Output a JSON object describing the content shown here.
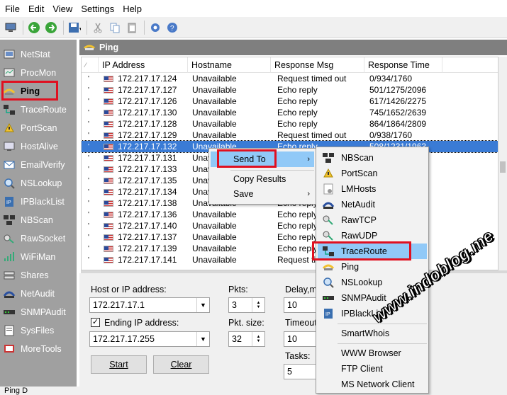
{
  "menu": [
    "File",
    "Edit",
    "View",
    "Settings",
    "Help"
  ],
  "toolbar_icons": [
    "monitor-icon",
    "back-icon",
    "forward-icon",
    "save-icon",
    "cut-icon",
    "copy-icon",
    "paste-icon",
    "settings-icon",
    "help-icon"
  ],
  "sidebar": {
    "items": [
      {
        "label": "NetStat",
        "icon": "netstat-icon"
      },
      {
        "label": "ProcMon",
        "icon": "procmon-icon"
      },
      {
        "label": "Ping",
        "icon": "ping-icon",
        "active": true
      },
      {
        "label": "TraceRoute",
        "icon": "traceroute-icon"
      },
      {
        "label": "PortScan",
        "icon": "portscan-icon"
      },
      {
        "label": "HostAlive",
        "icon": "hostalive-icon"
      },
      {
        "label": "EmailVerify",
        "icon": "email-icon"
      },
      {
        "label": "NSLookup",
        "icon": "nslookup-icon"
      },
      {
        "label": "IPBlackList",
        "icon": "ipblacklist-icon"
      },
      {
        "label": "NBScan",
        "icon": "nbscan-icon"
      },
      {
        "label": "RawSocket",
        "icon": "rawsocket-icon"
      },
      {
        "label": "WiFiMan",
        "icon": "wifi-icon"
      },
      {
        "label": "Shares",
        "icon": "shares-icon"
      },
      {
        "label": "NetAudit",
        "icon": "netaudit-icon"
      },
      {
        "label": "SNMPAudit",
        "icon": "snmpaudit-icon"
      },
      {
        "label": "SysFiles",
        "icon": "sysfiles-icon"
      },
      {
        "label": "MoreTools",
        "icon": "moretools-icon"
      }
    ]
  },
  "panel_title": "Ping",
  "table": {
    "columns": [
      "IP Address",
      "Hostname",
      "Response Msg",
      "Response Time"
    ],
    "rows": [
      {
        "ip": "172.217.17.124",
        "host": "Unavailable",
        "msg": "Request timed out",
        "time": "0/934/1760"
      },
      {
        "ip": "172.217.17.127",
        "host": "Unavailable",
        "msg": "Echo reply",
        "time": "501/1275/2096"
      },
      {
        "ip": "172.217.17.126",
        "host": "Unavailable",
        "msg": "Echo reply",
        "time": "617/1426/2275"
      },
      {
        "ip": "172.217.17.130",
        "host": "Unavailable",
        "msg": "Echo reply",
        "time": "745/1652/2639"
      },
      {
        "ip": "172.217.17.128",
        "host": "Unavailable",
        "msg": "Echo reply",
        "time": "864/1864/2809"
      },
      {
        "ip": "172.217.17.129",
        "host": "Unavailable",
        "msg": "Request timed out",
        "time": "0/938/1760"
      },
      {
        "ip": "172.217.17.132",
        "host": "Unavailable",
        "msg": "Echo reply",
        "time": "508/1231/1963",
        "selected": true
      },
      {
        "ip": "172.217.17.131",
        "host": "Unav",
        "msg": "",
        "time": ""
      },
      {
        "ip": "172.217.17.133",
        "host": "Unav",
        "msg": "",
        "time": ""
      },
      {
        "ip": "172.217.17.135",
        "host": "Unav",
        "msg": "",
        "time": ""
      },
      {
        "ip": "172.217.17.134",
        "host": "Unav",
        "msg": "",
        "time": "5"
      },
      {
        "ip": "172.217.17.138",
        "host": "Unavailable",
        "msg": "Echo reply",
        "time": ""
      },
      {
        "ip": "172.217.17.136",
        "host": "Unavailable",
        "msg": "Echo reply",
        "time": ""
      },
      {
        "ip": "172.217.17.140",
        "host": "Unavailable",
        "msg": "Echo reply",
        "time": ""
      },
      {
        "ip": "172.217.17.137",
        "host": "Unavailable",
        "msg": "Echo reply",
        "time": ""
      },
      {
        "ip": "172.217.17.139",
        "host": "Unavailable",
        "msg": "Echo reply",
        "time": ""
      },
      {
        "ip": "172.217.17.141",
        "host": "Unavailable",
        "msg": "Request ti",
        "time": ""
      }
    ]
  },
  "form": {
    "host_label": "Host or IP address:",
    "host_value": "172.217.17.1",
    "ending_checked": true,
    "ending_label": "Ending IP address:",
    "ending_value": "172.217.17.255",
    "pkts_label": "Pkts:",
    "pkts_value": "3",
    "pktsize_label": "Pkt. size:",
    "pktsize_value": "32",
    "delay_label": "Delay,m",
    "delay_value": "10",
    "timeout_label": "Timeout",
    "timeout_value": "10",
    "tasks_label": "Tasks:",
    "tasks_value": "5",
    "start_label": "Start",
    "clear_label": "Clear"
  },
  "context_menu": {
    "items": [
      "Send To",
      "Copy Results",
      "Save"
    ]
  },
  "submenu": {
    "items": [
      {
        "label": "NBScan",
        "icon": "nbscan-icon"
      },
      {
        "label": "PortScan",
        "icon": "portscan-icon"
      },
      {
        "label": "LMHosts",
        "icon": "lmhosts-icon"
      },
      {
        "label": "NetAudit",
        "icon": "netaudit-icon"
      },
      {
        "label": "RawTCP",
        "icon": "rawtcp-icon"
      },
      {
        "label": "RawUDP",
        "icon": "rawudp-icon"
      },
      {
        "label": "TraceRoute",
        "icon": "traceroute-icon",
        "hot": true
      },
      {
        "label": "Ping",
        "icon": "ping-icon"
      },
      {
        "label": "NSLookup",
        "icon": "nslookup-icon"
      },
      {
        "label": "SNMPAudit",
        "icon": "snmpaudit-icon"
      },
      {
        "label": "IPBlackList",
        "icon": "ipblacklist-icon"
      },
      {
        "label": "SmartWhois",
        "icon": ""
      },
      {
        "label": "WWW Browser",
        "icon": ""
      },
      {
        "label": "FTP Client",
        "icon": ""
      },
      {
        "label": "MS Network Client",
        "icon": ""
      }
    ]
  },
  "status_text": "Ping D",
  "watermark": "www.indoblog.me",
  "colors": {
    "highlight": "#e01020",
    "selection": "#3a7bd5",
    "menu_hot": "#91c9f7",
    "sidebar": "#a0a0a0"
  }
}
